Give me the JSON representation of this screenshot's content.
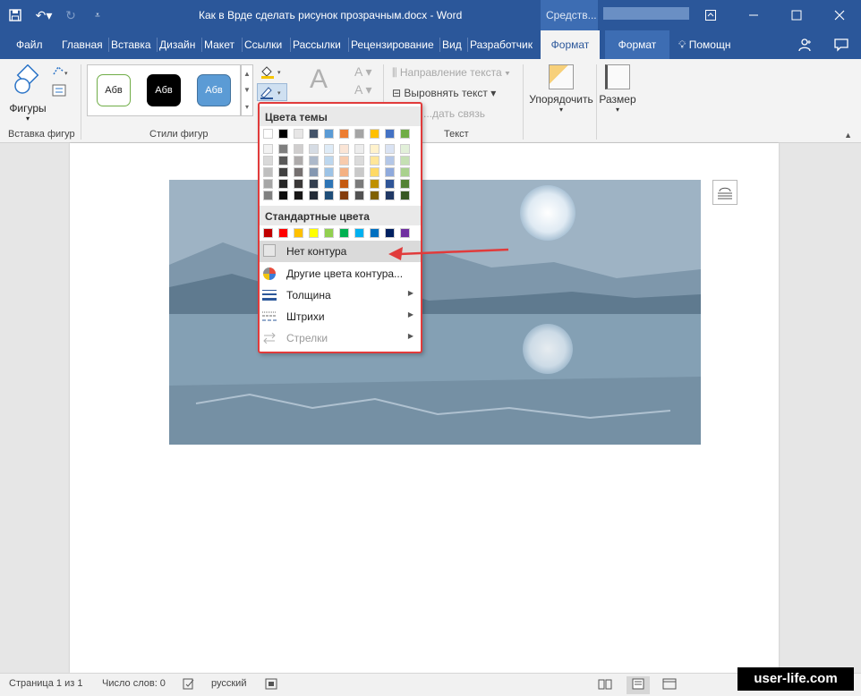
{
  "window": {
    "title": "Как в Врде сделать рисунок прозрачным.docx - Word",
    "tools_label": "Средств...",
    "qat": {
      "save_icon": "save-icon",
      "undo_icon": "undo-icon",
      "redo_icon": "redo-icon",
      "customize_icon": "customize-qat-icon"
    },
    "controls": [
      "ribbon-display-icon",
      "minimize-icon",
      "maximize-icon",
      "close-icon"
    ]
  },
  "tabs": [
    "Файл",
    "Главная",
    "Вставка",
    "Дизайн",
    "Макет",
    "Ссылки",
    "Рассылки",
    "Рецензирование",
    "Вид",
    "Разработчик",
    "Формат",
    "Формат"
  ],
  "help": "Помощн",
  "ribbon": {
    "shapes_label": "Фигуры",
    "insert_shapes_group": "Вставка фигур",
    "shape_styles_group": "Стили фигур",
    "text_group": "Текст",
    "style_samples": [
      "Абв",
      "Абв",
      "Абв"
    ],
    "text_direction": "Направление текста",
    "align_text": "Выровнять текст",
    "create_link": "...дать связь",
    "arrange": "Упорядочить",
    "size": "Размер"
  },
  "dropdown": {
    "theme_colors_header": "Цвета темы",
    "standard_colors_header": "Стандартные цвета",
    "theme_top_row": [
      "#ffffff",
      "#000000",
      "#e7e6e6",
      "#44546a",
      "#5b9bd5",
      "#ed7d31",
      "#a5a5a5",
      "#ffc000",
      "#4472c4",
      "#70ad47"
    ],
    "theme_shades": [
      [
        "#f2f2f2",
        "#d9d9d9",
        "#bfbfbf",
        "#a6a6a6",
        "#808080"
      ],
      [
        "#7f7f7f",
        "#595959",
        "#404040",
        "#262626",
        "#0d0d0d"
      ],
      [
        "#d0cece",
        "#aeabab",
        "#757070",
        "#3a3838",
        "#171616"
      ],
      [
        "#d6dce4",
        "#adb9ca",
        "#8497b0",
        "#333f4f",
        "#222a35"
      ],
      [
        "#deebf7",
        "#bdd7ee",
        "#9dc3e6",
        "#2e75b6",
        "#1f4e79"
      ],
      [
        "#fbe5d6",
        "#f8cbad",
        "#f4b183",
        "#c55a11",
        "#843c0c"
      ],
      [
        "#ededed",
        "#dbdbdb",
        "#c9c9c9",
        "#7b7b7b",
        "#525252"
      ],
      [
        "#fff2cc",
        "#ffe699",
        "#ffd966",
        "#bf9000",
        "#7f6000"
      ],
      [
        "#dae3f3",
        "#b4c7e7",
        "#8faadc",
        "#2f5597",
        "#203864"
      ],
      [
        "#e2f0d9",
        "#c5e0b4",
        "#a9d18e",
        "#548235",
        "#385723"
      ]
    ],
    "standard_colors": [
      "#c00000",
      "#ff0000",
      "#ffc000",
      "#ffff00",
      "#92d050",
      "#00b050",
      "#00b0f0",
      "#0070c0",
      "#002060",
      "#7030a0"
    ],
    "no_outline": "Нет контура",
    "more_colors": "Другие цвета контура...",
    "weight": "Толщина",
    "dashes": "Штрихи",
    "arrows": "Стрелки"
  },
  "status": {
    "page": "Страница 1 из 1",
    "words": "Число слов: 0",
    "language": "русский"
  },
  "watermark": "user-life.com"
}
